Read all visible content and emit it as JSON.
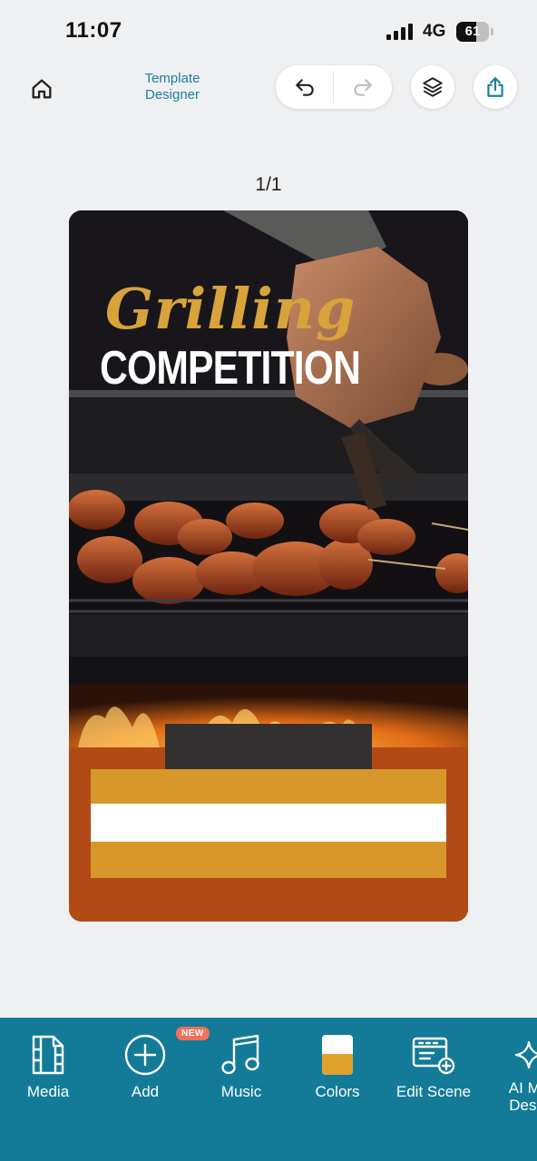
{
  "status_bar": {
    "time": "11:07",
    "network": "4G",
    "battery": "61"
  },
  "header": {
    "title": "Template Designer"
  },
  "canvas": {
    "page_indicator": "1/1",
    "script_text": "Grilling",
    "headline_text": "COMPETITION"
  },
  "toolbar": {
    "media": "Media",
    "add": "Add",
    "add_badge": "NEW",
    "music": "Music",
    "colors": "Colors",
    "edit_scene": "Edit Scene",
    "ai_line1": "AI Ma",
    "ai_line2": "Desig"
  },
  "colors": {
    "accent": "#1c7fa0",
    "toolbar_bg": "#137b97",
    "canvas_orange": "#b14a15",
    "canvas_gold": "#d8972a",
    "script_gold": "#d7a33a",
    "badge": "#f0705a"
  }
}
